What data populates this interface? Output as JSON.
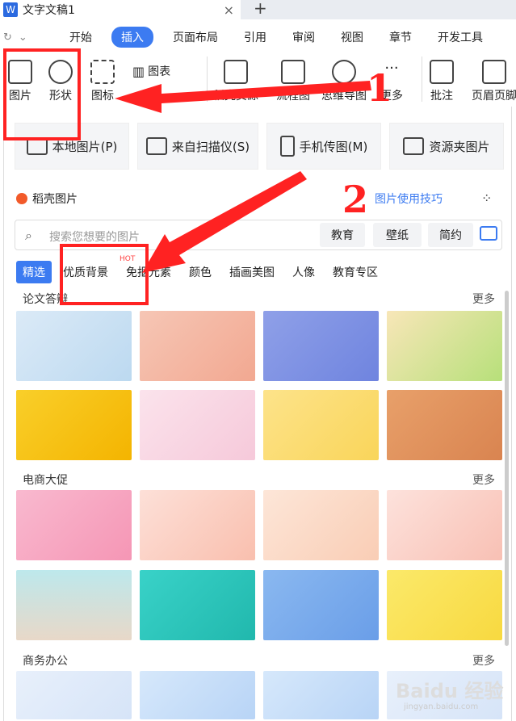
{
  "window": {
    "doc_title": "文字文稿1",
    "close": "×",
    "new_tab": "+"
  },
  "quick_access": {
    "redo": "↻",
    "dropdown": "⌄"
  },
  "ribbon_tabs": [
    "开始",
    "插入",
    "页面布局",
    "引用",
    "审阅",
    "视图",
    "章节",
    "开发工具"
  ],
  "ribbon_active": "插入",
  "toolbar": {
    "picture": "图片",
    "shape": "形状",
    "icon": "图标",
    "chart": "图表",
    "material": "稻壳资源",
    "flowchart": "流程图",
    "mindmap": "思维导图",
    "more": "更多",
    "comment": "批注",
    "header": "页眉页脚"
  },
  "sources": {
    "local": "本地图片(P)",
    "scanner": "来自扫描仪(S)",
    "phone": "手机传图(M)",
    "folder": "资源夹图片"
  },
  "daoke": {
    "label": "稻壳图片",
    "tips": "图片使用技巧"
  },
  "search": {
    "placeholder": "搜索您想要的图片"
  },
  "chips": [
    "教育",
    "壁纸",
    "简约"
  ],
  "categories": [
    "精选",
    "优质背景",
    "免抠元素",
    "颜色",
    "插画美图",
    "人像",
    "教育专区"
  ],
  "hot_badge": "HOT",
  "sections": [
    {
      "title": "论文答辩",
      "more": "更多"
    },
    {
      "title": "电商大促",
      "more": "更多"
    },
    {
      "title": "商务办公",
      "more": "更多"
    }
  ],
  "annotations": {
    "one": "1",
    "two": "2"
  },
  "watermark": {
    "brand": "Baidu 经验",
    "url": "jingyan.baidu.com"
  },
  "colors": {
    "accent": "#3c7bf1",
    "annotation_red": "#ff2222"
  }
}
